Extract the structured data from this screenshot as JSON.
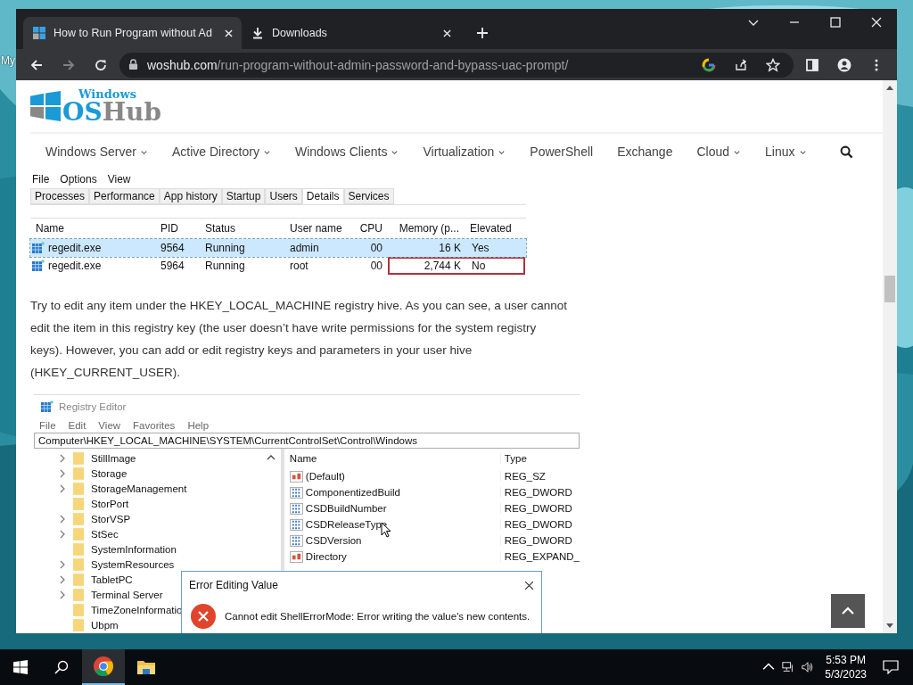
{
  "desktop": {
    "icon_labels": [
      "My"
    ]
  },
  "browser": {
    "tabs": [
      {
        "title": "How to Run Program without Ad",
        "kind": "site",
        "selected": true
      },
      {
        "title": "Downloads",
        "kind": "download",
        "selected": false
      }
    ],
    "url": {
      "host": "woshub.com",
      "path": "/run-program-without-admin-password-and-bypass-uac-prompt/"
    }
  },
  "site": {
    "logo": {
      "small": "Windows",
      "large_blue": "OS",
      "large_grey": "Hub"
    },
    "nav": [
      {
        "label": "Windows Server",
        "dropdown": true
      },
      {
        "label": "Active Directory",
        "dropdown": true
      },
      {
        "label": "Windows Clients",
        "dropdown": true
      },
      {
        "label": "Virtualization",
        "dropdown": true
      },
      {
        "label": "PowerShell",
        "dropdown": false
      },
      {
        "label": "Exchange",
        "dropdown": false
      },
      {
        "label": "Cloud",
        "dropdown": true
      },
      {
        "label": "Linux",
        "dropdown": true
      }
    ],
    "task_manager": {
      "menu": [
        "File",
        "Options",
        "View"
      ],
      "tabs": [
        {
          "label": "Processes",
          "selected": false
        },
        {
          "label": "Performance",
          "selected": false
        },
        {
          "label": "App history",
          "selected": false
        },
        {
          "label": "Startup",
          "selected": false
        },
        {
          "label": "Users",
          "selected": false
        },
        {
          "label": "Details",
          "selected": true
        },
        {
          "label": "Services",
          "selected": false
        }
      ],
      "columns": [
        "Name",
        "PID",
        "Status",
        "User name",
        "CPU",
        "Memory (p...",
        "Elevated"
      ],
      "rows": [
        {
          "cells": [
            "regedit.exe",
            "9564",
            "Running",
            "admin",
            "00",
            "16 K",
            "Yes"
          ],
          "selected": true,
          "highlighted": false
        },
        {
          "cells": [
            "regedit.exe",
            "5964",
            "Running",
            "root",
            "00",
            "2,744 K",
            "No"
          ],
          "selected": false,
          "highlighted": true
        }
      ]
    },
    "paragraph": "Try to edit any item under the HKEY_LOCAL_MACHINE registry hive. As you can see, a user cannot edit the item in this registry key (the user doesn’t have write permissions for the system registry keys). However, you can add or edit registry keys and parameters in your user hive (HKEY_CURRENT_USER).",
    "registry_editor": {
      "title": "Registry Editor",
      "menu": [
        "File",
        "Edit",
        "View",
        "Favorites",
        "Help"
      ],
      "address": "Computer\\HKEY_LOCAL_MACHINE\\SYSTEM\\CurrentControlSet\\Control\\Windows",
      "tree": [
        {
          "label": "StillImage",
          "expandable": true
        },
        {
          "label": "Storage",
          "expandable": true
        },
        {
          "label": "StorageManagement",
          "expandable": true
        },
        {
          "label": "StorPort",
          "expandable": false
        },
        {
          "label": "StorVSP",
          "expandable": true
        },
        {
          "label": "StSec",
          "expandable": true
        },
        {
          "label": "SystemInformation",
          "expandable": false
        },
        {
          "label": "SystemResources",
          "expandable": true
        },
        {
          "label": "TabletPC",
          "expandable": true
        },
        {
          "label": "Terminal Server",
          "expandable": true
        },
        {
          "label": "TimeZoneInformatio",
          "expandable": false
        },
        {
          "label": "Ubpm",
          "expandable": false
        }
      ],
      "list_columns": [
        "Name",
        "Type"
      ],
      "values": [
        {
          "name": "(Default)",
          "type": "REG_SZ",
          "kind": "string"
        },
        {
          "name": "ComponentizedBuild",
          "type": "REG_DWORD",
          "kind": "binary"
        },
        {
          "name": "CSDBuildNumber",
          "type": "REG_DWORD",
          "kind": "binary"
        },
        {
          "name": "CSDReleaseType",
          "type": "REG_DWORD",
          "kind": "binary"
        },
        {
          "name": "CSDVersion",
          "type": "REG_DWORD",
          "kind": "binary"
        },
        {
          "name": "Directory",
          "type": "REG_EXPAND_",
          "kind": "string"
        }
      ],
      "dialog": {
        "title": "Error Editing Value",
        "message": "Cannot edit ShellErrorMode:  Error writing the value's new contents."
      }
    }
  },
  "taskbar": {
    "apps": [
      {
        "kind": "chrome",
        "active": true
      },
      {
        "kind": "explorer",
        "active": false
      }
    ],
    "time": "5:53 PM",
    "date": "5/3/2023"
  }
}
